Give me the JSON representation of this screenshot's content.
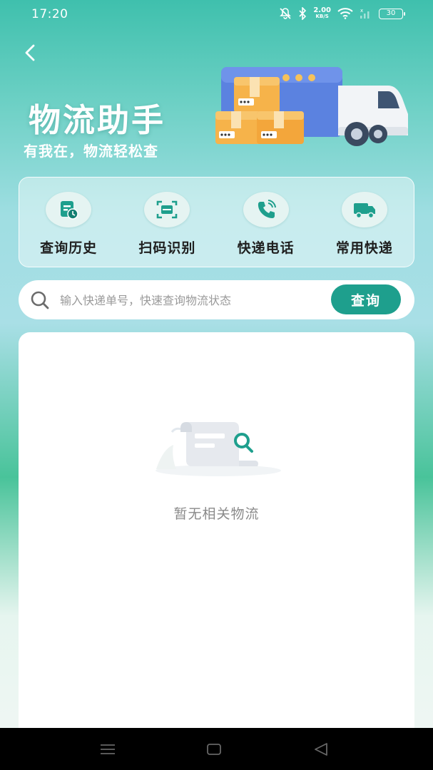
{
  "status_bar": {
    "time": "17:20",
    "net_speed": "2.00",
    "net_unit": "KB/S",
    "battery": "30",
    "icons": [
      "mute-icon",
      "bluetooth-icon",
      "wifi-icon",
      "signal-icon",
      "battery-icon"
    ]
  },
  "header": {
    "back_icon": "chevron-left-icon",
    "title": "物流助手",
    "subtitle": "有我在，物流轻松查",
    "illustration": "delivery-truck-with-boxes"
  },
  "quick_actions": [
    {
      "label": "查询历史",
      "icon": "history-icon"
    },
    {
      "label": "扫码识别",
      "icon": "scan-icon"
    },
    {
      "label": "快递电话",
      "icon": "phone-icon"
    },
    {
      "label": "常用快递",
      "icon": "truck-icon"
    }
  ],
  "search": {
    "placeholder": "输入快递单号，快速查询物流状态",
    "value": "",
    "button_label": "查询"
  },
  "results": {
    "empty_text": "暂无相关物流",
    "illustration": "empty-document-search"
  },
  "nav_bar": {
    "icons": [
      "menu-icon",
      "home-icon",
      "back-icon"
    ]
  },
  "colors": {
    "accent": "#1e9f8d",
    "accent_light": "#e5f4f2",
    "text_dark": "#1f1f1f",
    "muted": "#8a8a8a"
  }
}
